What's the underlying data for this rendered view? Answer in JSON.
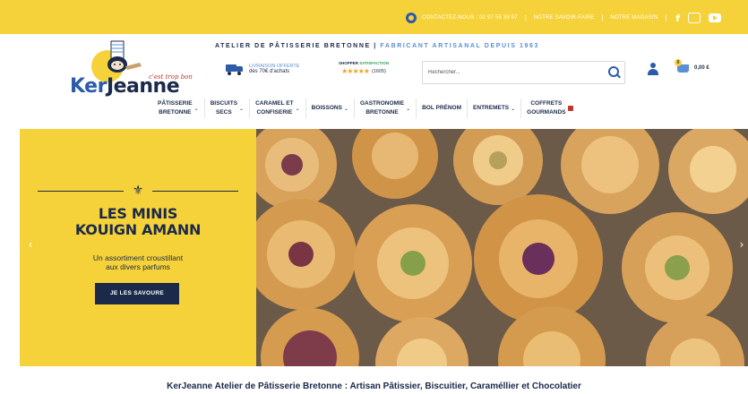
{
  "topbar": {
    "contact": "CONTACTEZ-NOUS : 02 97 55 38 97",
    "savoir_faire": "NOTRE SAVOIR-FAIRE",
    "magasin": "NOTRE MAGASIN",
    "icons": [
      "facebook-icon",
      "instagram-icon",
      "youtube-icon"
    ],
    "background": "#f6d23a"
  },
  "logo": {
    "ker": "Ker",
    "jeanne": "Jeanne",
    "script": "c'est trop bon"
  },
  "header": {
    "atelier_prefix": "ATELIER DE PÂTISSERIE BRETONNE |",
    "atelier_highlight": "FABRICANT ARTISANAL DEPUIS 1963",
    "delivery_title": "LIVRAISON OFFERTE",
    "delivery_sub": "dès 70€ d'achats",
    "rating_brand_prefix": "SHOPPER",
    "rating_brand_highlight": "SATISFACTION",
    "stars": "★★★★★",
    "rating_count": "(1605)",
    "search_placeholder": "Rechercher...",
    "cart_count": "0",
    "cart_total": "0,00 €"
  },
  "nav": {
    "items": [
      {
        "label": "PÂTISSERIE\nBRETONNE",
        "has_chevron": true
      },
      {
        "label": "BISCUITS\nSECS",
        "has_chevron": true
      },
      {
        "label": "CARAMEL ET\nCONFISERIE",
        "has_chevron": true
      },
      {
        "label": "BOISSONS",
        "has_chevron": true
      },
      {
        "label": "GASTRONOMIE\nBRETONNE",
        "has_chevron": true
      },
      {
        "label": "BOL PRÉNOM",
        "has_chevron": false
      },
      {
        "label": "ENTREMETS",
        "has_chevron": true
      },
      {
        "label": "COFFRETS\nGOURMANDS",
        "has_chevron": false
      }
    ],
    "chevron": "⌄"
  },
  "hero": {
    "ermine": "⚜",
    "title_line1": "LES MINIS",
    "title_line2": "KOUIGN AMANN",
    "sub_line1": "Un assortiment croustillant",
    "sub_line2": "aux divers parfums",
    "button": "JE LES SAVOURE",
    "prev": "‹",
    "next": "›"
  },
  "page": {
    "title": "KerJeanne Atelier de Pâtisserie Bretonne : Artisan Pâtissier, Biscuitier, Caraméllier et Chocolatier"
  },
  "colors": {
    "brand_yellow": "#f6d23a",
    "brand_navy": "#1b2a4a",
    "brand_blue": "#2d5ba8",
    "accent_blue": "#5a8fd6"
  }
}
